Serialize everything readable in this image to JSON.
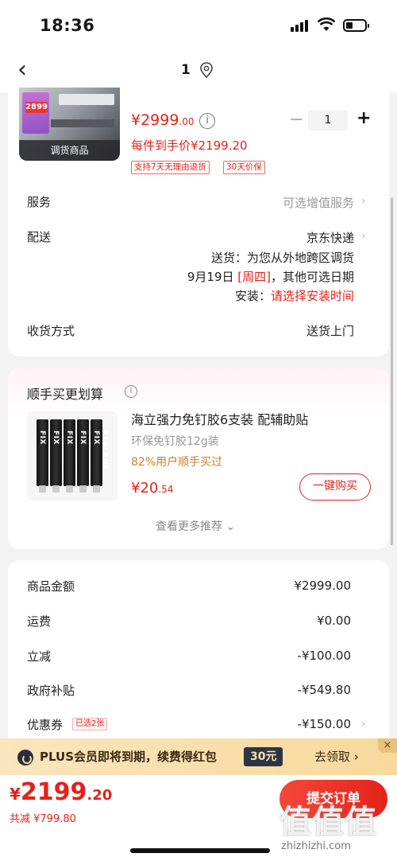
{
  "status_bar": {
    "time": "18:36"
  },
  "nav": {
    "back": "‹",
    "count": "1"
  },
  "product": {
    "badge": "调货商品",
    "price_int": "¥2999",
    "price_dec": ".00",
    "quantity": "1",
    "hand_price": "每件到手价¥2199.20",
    "tags": [
      "支持7天无理由退货",
      "30天价保"
    ]
  },
  "service": {
    "label": "服务",
    "value": "可选增值服务"
  },
  "delivery": {
    "label": "配送",
    "carrier": "京东快递",
    "ship_prefix": "送货：",
    "ship_text": "为您从外地跨区调货",
    "date_prefix": "9月19日 ",
    "date_weekday": "[周四]",
    "date_suffix": "，其他可选日期",
    "install_prefix": "安装：",
    "install_text": "请选择安装时间"
  },
  "receive": {
    "label": "收货方式",
    "value": "送货上门"
  },
  "recommend": {
    "title": "顺手买更划算",
    "item_name": "海立强力免钉胶6支装 配辅助贴",
    "item_spec": "环保免钉胶12g装",
    "item_buyers": "82%用户顺手买过",
    "price_int": "¥20",
    "price_dec": ".54",
    "buy_label": "一键购买",
    "more_label": "查看更多推荐 ⌄",
    "tube_text": "SEALANT FIX"
  },
  "summary": {
    "rows": [
      {
        "label": "商品金额",
        "value": "¥2999.00"
      },
      {
        "label": "运费",
        "value": "¥0.00"
      },
      {
        "label": "立减",
        "value": "-¥100.00"
      },
      {
        "label": "政府补贴",
        "value": "-¥549.80"
      },
      {
        "label": "优惠券",
        "value": "-¥150.00"
      }
    ],
    "coupon_tag": "已选2张"
  },
  "plus_banner": {
    "text": "PLUS会员即将到期，续费得红包",
    "amount": "30元",
    "link": "去领取 ›",
    "close": "×"
  },
  "bottom": {
    "yen": "¥",
    "total_int": "2199",
    "total_dec": ".20",
    "saved": "共减 ¥799.80",
    "submit": "提交订单",
    "watermark": "值值值",
    "watermark_url": "zhizhizhi.com"
  },
  "colors": {
    "accent": "#e2231a",
    "plus_gold": "#f7d99b",
    "plus_dark": "#2c3446"
  }
}
